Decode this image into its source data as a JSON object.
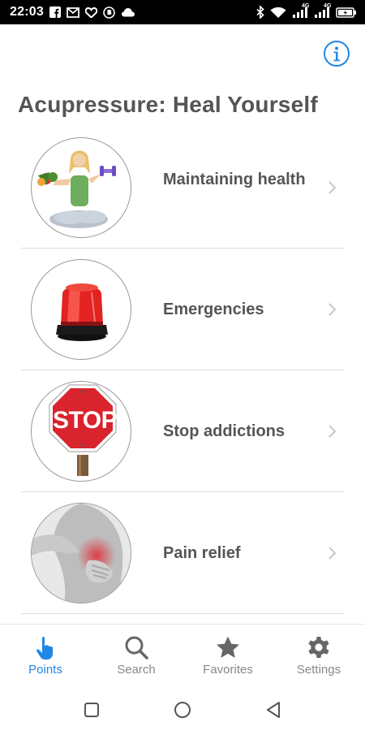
{
  "status_bar": {
    "time": "22:03",
    "network_badge_1": "4G",
    "network_badge_2": "4G",
    "left_icons": [
      "facebook-icon",
      "gmail-icon",
      "heart-app-icon",
      "b-circle-icon",
      "cloud-icon"
    ],
    "right_icons": [
      "bluetooth-icon",
      "wifi-icon",
      "signal-icon",
      "signal-icon",
      "battery-icon"
    ]
  },
  "header": {
    "title": "Acupressure: Heal Yourself",
    "info_icon": "info-icon",
    "accent_color": "#1e88e5"
  },
  "categories": [
    {
      "label": "Maintaining health",
      "image": "woman-meditating-with-vegetables-and-dumbbells"
    },
    {
      "label": "Emergencies",
      "image": "red-emergency-siren-light"
    },
    {
      "label": "Stop addictions",
      "image": "stop-sign",
      "image_text": "STOP"
    },
    {
      "label": "Pain relief",
      "image": "person-holding-lower-back"
    }
  ],
  "bottom_nav": {
    "active": "Points",
    "items": [
      {
        "label": "Points",
        "icon": "pointing-hand-icon"
      },
      {
        "label": "Search",
        "icon": "search-icon"
      },
      {
        "label": "Favorites",
        "icon": "star-icon"
      },
      {
        "label": "Settings",
        "icon": "gear-icon"
      }
    ]
  },
  "system_nav": {
    "buttons": [
      "recent-apps-square-icon",
      "home-circle-icon",
      "back-triangle-icon"
    ]
  }
}
